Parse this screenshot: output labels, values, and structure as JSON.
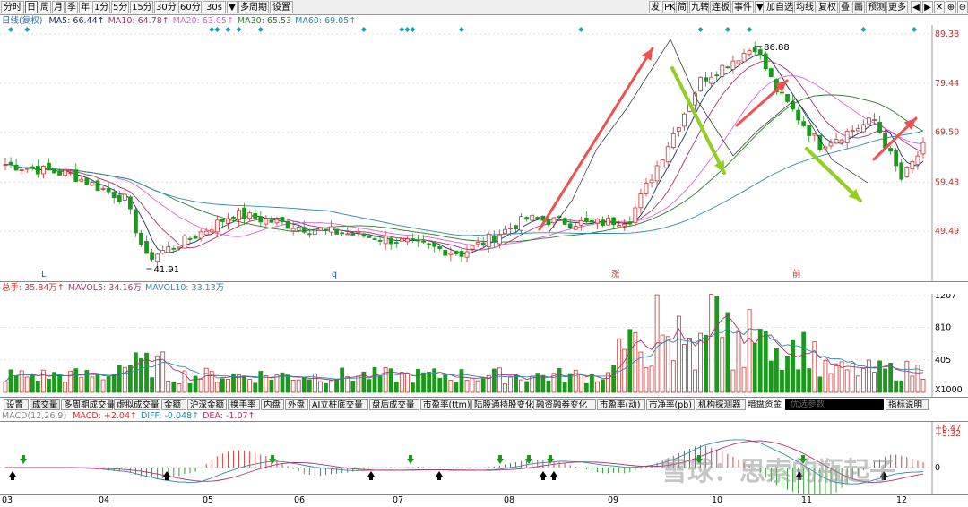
{
  "toolbar": {
    "left_tabs": [
      "分时",
      "日",
      "周",
      "月",
      "季",
      "年",
      "1分",
      "5分",
      "15分",
      "30分",
      "60分",
      "30s",
      "▼",
      "多周期",
      "设置"
    ],
    "active_left": "日",
    "right_tabs": [
      "发",
      "PK",
      "简",
      "九转",
      "连板",
      "事件",
      "▼",
      "加自选",
      "均线",
      "复权",
      "叠",
      "画",
      "预测",
      "更多"
    ],
    "icons": [
      "◀",
      "▶",
      "✕",
      "⊕",
      "⊖",
      "▶|"
    ]
  },
  "main_legend": {
    "name": "日线(复权)",
    "ma": [
      {
        "label": "MA5: 66.44↑",
        "color": "#1a2b6b"
      },
      {
        "label": "MA10: 64.78↑",
        "color": "#b03070"
      },
      {
        "label": "MA20: 63.05↑",
        "color": "#e060e0"
      },
      {
        "label": "MA30: 65.53",
        "color": "#2a7a2a"
      },
      {
        "label": "MA60: 69.05↑",
        "color": "#2a8ab0"
      }
    ]
  },
  "price_axis": [
    "89.38",
    "79.44",
    "69.50",
    "59.43",
    "49.49"
  ],
  "annotations": {
    "high": "86.88",
    "low": "41.91",
    "markers": [
      "L",
      "q",
      "涨",
      "前"
    ]
  },
  "volume_legend": {
    "items": [
      {
        "label": "总手: 35.84万↑",
        "color": "#d03030"
      },
      {
        "label": "MAVOL5: 34.16万",
        "color": "#b03070"
      },
      {
        "label": "MAVOL10: 33.13万",
        "color": "#2a8ab0"
      }
    ]
  },
  "volume_axis": [
    "1207",
    "810",
    "405"
  ],
  "volume_unit": "X1000",
  "bottom_tabs": [
    "设置",
    "成交量",
    "多周期成交量",
    "虚拟成交量",
    "金额",
    "沪深金额",
    "换手率",
    "内盘",
    "外盘",
    "AI立桩底交量",
    "盘后成交量",
    "市盈率(ttm)",
    "陆股通持股变化",
    "融资融券变化",
    "市盈率(动)",
    "市净率(pb)",
    "机构探测器"
  ],
  "active_bottom": "成交量",
  "right_panel": {
    "label": "暗盘资金",
    "input_placeholder": "优选参数",
    "help": "指标说明"
  },
  "macd_legend": {
    "name": "MACD(12,26,9)",
    "items": [
      {
        "label": "MACD: +2.04↑",
        "color": "#d03030"
      },
      {
        "label": "DIFF: -0.048↑",
        "color": "#2a8ab0"
      },
      {
        "label": "DEA: -1.07↑",
        "color": "#b03070"
      }
    ]
  },
  "macd_axis": [
    "+6.47",
    "+5.32",
    "0"
  ],
  "months": [
    "03",
    "04",
    "05",
    "06",
    "07",
    "08",
    "09",
    "10",
    "11",
    "12"
  ],
  "watermark": "雪球：思索的瓶起子",
  "colors": {
    "up": "#d03030",
    "down": "#1a9a1a",
    "arrow_red": "#f05050",
    "arrow_green": "#90d020",
    "diamond": "#20a0b0"
  },
  "chart_data": {
    "type": "candlestick",
    "x": [
      "03",
      "04",
      "05",
      "06",
      "07",
      "08",
      "09",
      "10",
      "11",
      "12"
    ],
    "price_range": [
      41.91,
      89.38
    ],
    "high": 86.88,
    "low": 41.91,
    "volume_range": [
      0,
      1207
    ]
  }
}
